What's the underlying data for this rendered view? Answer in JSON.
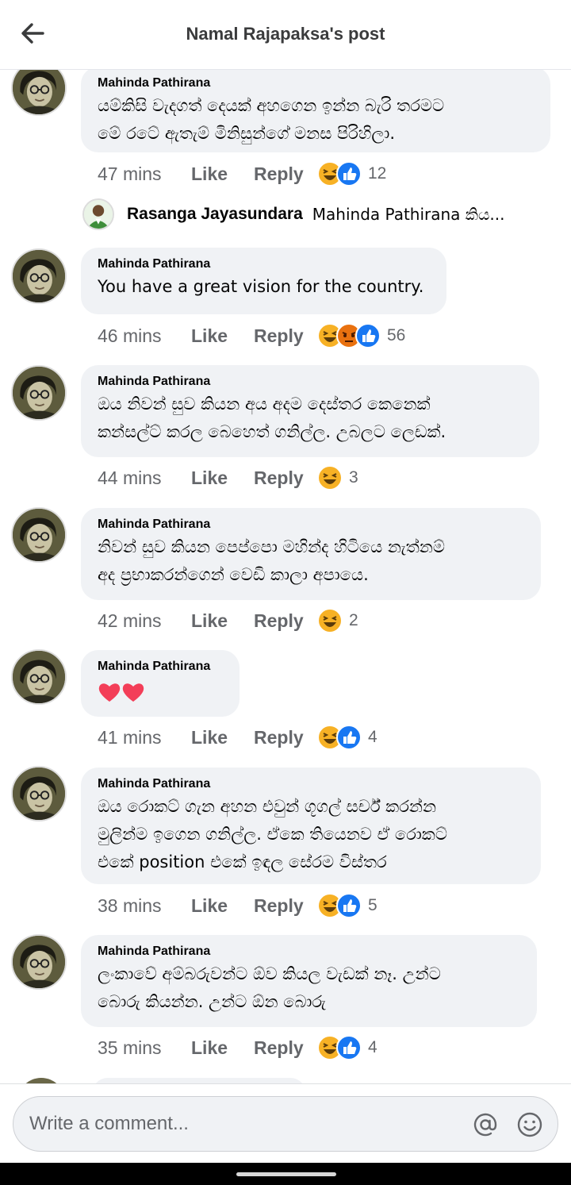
{
  "header": {
    "title": "Namal Rajapaksa's post"
  },
  "reply_preview": {
    "author": "Rasanga Jayasundara",
    "snippet": "Mahinda Pathirana කිය..."
  },
  "comments": [
    {
      "author": "Mahinda Pathirana",
      "lines": [
        "යම්කිසි වැදගත් දෙයක් අහගෙන ඉන්න බැරි තරමට",
        "මේ රටේ ඇතැම් මිනිසුන්ගේ මනස පිරිහිලා."
      ],
      "time": "47 mins",
      "reactions": [
        "haha",
        "like"
      ],
      "count": "12"
    },
    {
      "author": "Mahinda Pathirana",
      "lines": [
        "You have a great vision for the country."
      ],
      "time": "46 mins",
      "reactions": [
        "haha",
        "angry",
        "like"
      ],
      "count": "56"
    },
    {
      "author": "Mahinda Pathirana",
      "lines": [
        "ඔය නිවන් සුව කියන අය අදම දෙස්තර කෙනෙක්",
        "කන්සල්ට් කරල බෙහෙත් ගනිල්ල. උබලට ලෙඩක්."
      ],
      "time": "44 mins",
      "reactions": [
        "haha"
      ],
      "count": "3"
    },
    {
      "author": "Mahinda Pathirana",
      "lines": [
        "නිවන් සුව කියන පෙප්පො මහින්ද හිටියෙ නැත්නම්",
        "අද ප්‍රභාකරන්ගෙන් වෙඩි කාලා අපායෙ."
      ],
      "time": "42 mins",
      "reactions": [
        "haha"
      ],
      "count": "2"
    },
    {
      "author": "Mahinda Pathirana",
      "lines": [],
      "hearts": "❤❤",
      "time": "41 mins",
      "reactions": [
        "haha",
        "like"
      ],
      "count": "4"
    },
    {
      "author": "Mahinda Pathirana",
      "lines": [
        "ඔය රොකට් ගැන අහන එවුන් ගූගල් සර්ච් කරන්න",
        "මුලින්ම ඉගෙන ගනිල්ල. ඒකෙ තියෙනව ඒ රොකට්",
        "එකේ position එකේ ඉඳල සේරම විස්තර"
      ],
      "time": "38 mins",
      "reactions": [
        "haha",
        "like"
      ],
      "count": "5"
    },
    {
      "author": "Mahinda Pathirana",
      "lines": [
        "ලංකාවේ අම්බරුවන්ට ඕව කියල වැඩක් නෑ. උන්ට",
        "බොරු කියන්න. උන්ට ඕන බොරු"
      ],
      "time": "35 mins",
      "reactions": [
        "haha",
        "like"
      ],
      "count": "4"
    }
  ],
  "actions": {
    "like_label": "Like",
    "reply_label": "Reply"
  },
  "composer": {
    "placeholder": "Write a comment..."
  },
  "colors": {
    "bubble": "#f0f2f5",
    "like_blue": "#1877f2",
    "haha_yellow": "#f7b125",
    "angry": "#e9710f",
    "heart": "#f33e58"
  },
  "icons": {
    "back": "arrow-left-icon",
    "mention": "at-icon",
    "emoji": "smiley-icon"
  }
}
